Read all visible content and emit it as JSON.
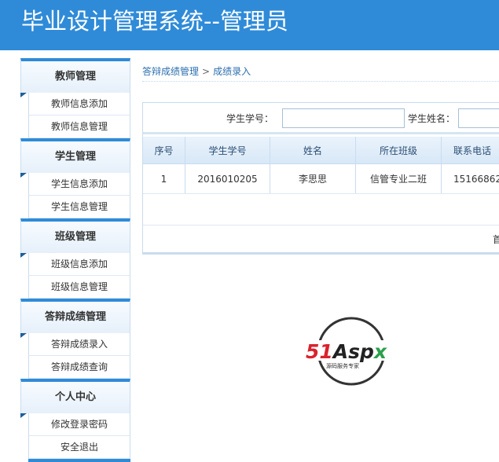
{
  "header": {
    "title": "毕业设计管理系统--管理员"
  },
  "sidebar": {
    "groups": [
      {
        "title": "教师管理",
        "items": [
          "教师信息添加",
          "教师信息管理"
        ]
      },
      {
        "title": "学生管理",
        "items": [
          "学生信息添加",
          "学生信息管理"
        ]
      },
      {
        "title": "班级管理",
        "items": [
          "班级信息添加",
          "班级信息管理"
        ]
      },
      {
        "title": "答辩成绩管理",
        "items": [
          "答辩成绩录入",
          "答辩成绩查询"
        ]
      },
      {
        "title": "个人中心",
        "items": [
          "修改登录密码",
          "安全退出"
        ]
      }
    ]
  },
  "breadcrumb": {
    "parent": "答辩成绩管理",
    "separator": ">",
    "current": "成绩录入"
  },
  "search": {
    "student_id_label": "学生学号：",
    "student_id_value": "",
    "student_name_label": "学生姓名：",
    "student_name_value": ""
  },
  "table": {
    "headers": [
      "序号",
      "学生学号",
      "姓名",
      "所在班级",
      "联系电话"
    ],
    "rows": [
      [
        "1",
        "2016010205",
        "李思思",
        "信管专业二班",
        "15166862"
      ]
    ]
  },
  "pager": {
    "first": "首"
  },
  "logo": {
    "brand": "51Aspx",
    "tagline": "源码服务专家"
  },
  "colors": {
    "header_bg": "#2f8bd8",
    "accent_dark": "#1d5f9a",
    "link": "#2c6fae",
    "logo_red": "#d9232d",
    "logo_green": "#2aa14a"
  }
}
